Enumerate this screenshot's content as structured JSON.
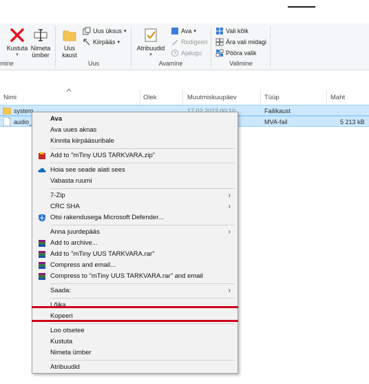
{
  "ribbon": {
    "left_group_label": "mine",
    "buttons": {
      "delete": "Kustuta",
      "rename_line1": "Nimeta",
      "rename_line2": "ümber",
      "new_folder_line1": "Uus",
      "new_folder_line2": "kaust",
      "new_item": "Uus üksus",
      "easy_access": "Kiirpääs",
      "properties": "Atribuudid",
      "open": "Ava",
      "edit": "Redigeeri",
      "history": "Ajalugu",
      "select_all": "Vali kõik",
      "select_none": "Ära vali midagi",
      "invert_selection": "Pööra valik"
    },
    "groups": {
      "new": "Uus",
      "open": "Avamine",
      "select": "Valimine"
    }
  },
  "file_list": {
    "columns": [
      "Nimi",
      "Olek",
      "Muutmiskuupäev",
      "Tüüp",
      "Maht"
    ],
    "rows": [
      {
        "name": "system",
        "type": "Failikaust",
        "size": "",
        "date": "17.02.2022 00:10"
      },
      {
        "name": "audio_",
        "type": "MVA-fail",
        "size": "5 213 kB"
      }
    ]
  },
  "context_menu": {
    "items": [
      {
        "label": "Ava",
        "bold": true
      },
      {
        "label": "Ava uues aknas"
      },
      {
        "label": "Kinnita kiirpääsuribale"
      },
      {
        "label": "Add to \"mTiny UUS TARKVARA.zip\"",
        "icon": "winzip-icon"
      },
      {
        "label": "Hoia see seade alati sees",
        "icon": "onedrive-cloud-icon"
      },
      {
        "label": "Vabasta ruumi"
      },
      {
        "label": "7-Zip",
        "submenu": true
      },
      {
        "label": "CRC SHA",
        "submenu": true
      },
      {
        "label": "Otsi rakendusega Microsoft Defender...",
        "icon": "defender-icon"
      },
      {
        "label": "Anna juurdepääs",
        "submenu": true
      },
      {
        "label": "Add to archive...",
        "icon": "winrar-icon"
      },
      {
        "label": "Add to \"mTiny UUS TARKVARA.rar\"",
        "icon": "winrar-icon"
      },
      {
        "label": "Compress and email...",
        "icon": "winrar-icon"
      },
      {
        "label": "Compress to \"mTiny UUS TARKVARA.rar\" and email",
        "icon": "winrar-icon"
      },
      {
        "label": "Saada:",
        "submenu": true
      },
      {
        "label": "Lõika"
      },
      {
        "label": "Kopeeri"
      },
      {
        "label": "Loo otsetee"
      },
      {
        "label": "Kustuta"
      },
      {
        "label": "Nimeta ümber"
      },
      {
        "label": "Atribuudid"
      }
    ]
  },
  "colors": {
    "highlight_line": "#d0021b",
    "selection": "#cce8ff"
  }
}
